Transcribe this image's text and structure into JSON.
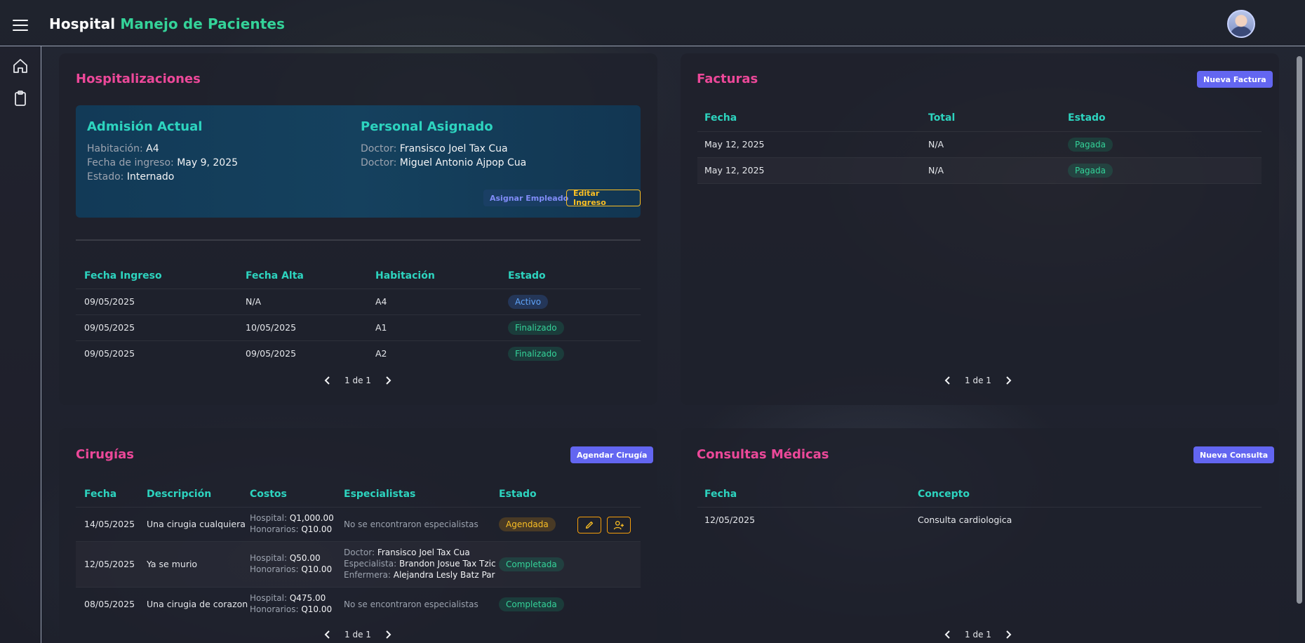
{
  "header": {
    "brand_1": "Hospital",
    "brand_2": "Manejo de Pacientes"
  },
  "sidebar": {
    "icons": [
      "home-icon",
      "clipboard-icon"
    ]
  },
  "hospitalizaciones": {
    "title": "Hospitalizaciones",
    "admision": {
      "heading": "Admisión Actual",
      "habitacion_label": "Habitación:",
      "habitacion_value": "A4",
      "fecha_label": "Fecha de ingreso:",
      "fecha_value": "May 9, 2025",
      "estado_label": "Estado:",
      "estado_value": "Internado"
    },
    "personal": {
      "heading": "Personal Asignado",
      "doctor_label": "Doctor:",
      "doctor_1": "Fransisco Joel Tax Cua",
      "doctor_2": "Miguel Antonio Ajpop Cua"
    },
    "asignar_label": "Asignar Empleado",
    "editar_label": "Editar Ingreso",
    "columns": [
      "Fecha Ingreso",
      "Fecha Alta",
      "Habitación",
      "Estado"
    ],
    "rows": [
      [
        "09/05/2025",
        "N/A",
        "A4",
        "Activo"
      ],
      [
        "09/05/2025",
        "10/05/2025",
        "A1",
        "Finalizado"
      ],
      [
        "09/05/2025",
        "09/05/2025",
        "A2",
        "Finalizado"
      ]
    ],
    "pager": "1 de 1"
  },
  "facturas": {
    "title": "Facturas",
    "new_label": "Nueva Factura",
    "columns": [
      "Fecha",
      "Total",
      "Estado"
    ],
    "rows": [
      [
        "May 12, 2025",
        "N/A",
        "Pagada"
      ],
      [
        "May 12, 2025",
        "N/A",
        "Pagada"
      ]
    ],
    "pager": "1 de 1"
  },
  "cirugias": {
    "title": "Cirugías",
    "new_label": "Agendar Cirugía",
    "columns": [
      "Fecha",
      "Descripción",
      "Costos",
      "Especialistas",
      "Estado"
    ],
    "hospital_label": "Hospital:",
    "honorarios_label": "Honorarios:",
    "rows": [
      {
        "fecha": "14/05/2025",
        "descripcion": "Una cirugia cualquiera",
        "hospital": "Q1,000.00",
        "honorarios": "Q10.00",
        "especialistas_empty": "No se encontraron especialistas",
        "estado": "Agendada"
      },
      {
        "fecha": "12/05/2025",
        "descripcion": "Ya se murio",
        "hospital": "Q50.00",
        "honorarios": "Q10.00",
        "esp_1_label": "Doctor:",
        "esp_1_value": "Fransisco Joel Tax Cua",
        "esp_2_label": "Especialista:",
        "esp_2_value": "Brandon Josue Tax Tzic",
        "esp_3_label": "Enfermera:",
        "esp_3_value": "Alejandra Lesly Batz Par",
        "estado": "Completada"
      },
      {
        "fecha": "08/05/2025",
        "descripcion": "Una cirugia de corazon",
        "hospital": "Q475.00",
        "honorarios": "Q10.00",
        "especialistas_empty": "No se encontraron especialistas",
        "estado": "Completada"
      }
    ],
    "pager": "1 de 1"
  },
  "consultas": {
    "title": "Consultas Médicas",
    "new_label": "Nueva Consulta",
    "columns": [
      "Fecha",
      "Concepto"
    ],
    "rows": [
      [
        "12/05/2025",
        "Consulta cardiologica"
      ]
    ],
    "pager": "1 de 1"
  },
  "colors": {
    "accent_pink": "#ec4899",
    "accent_teal": "#2dd4bf",
    "primary": "#6366f1",
    "brand_green": "#34d399"
  }
}
